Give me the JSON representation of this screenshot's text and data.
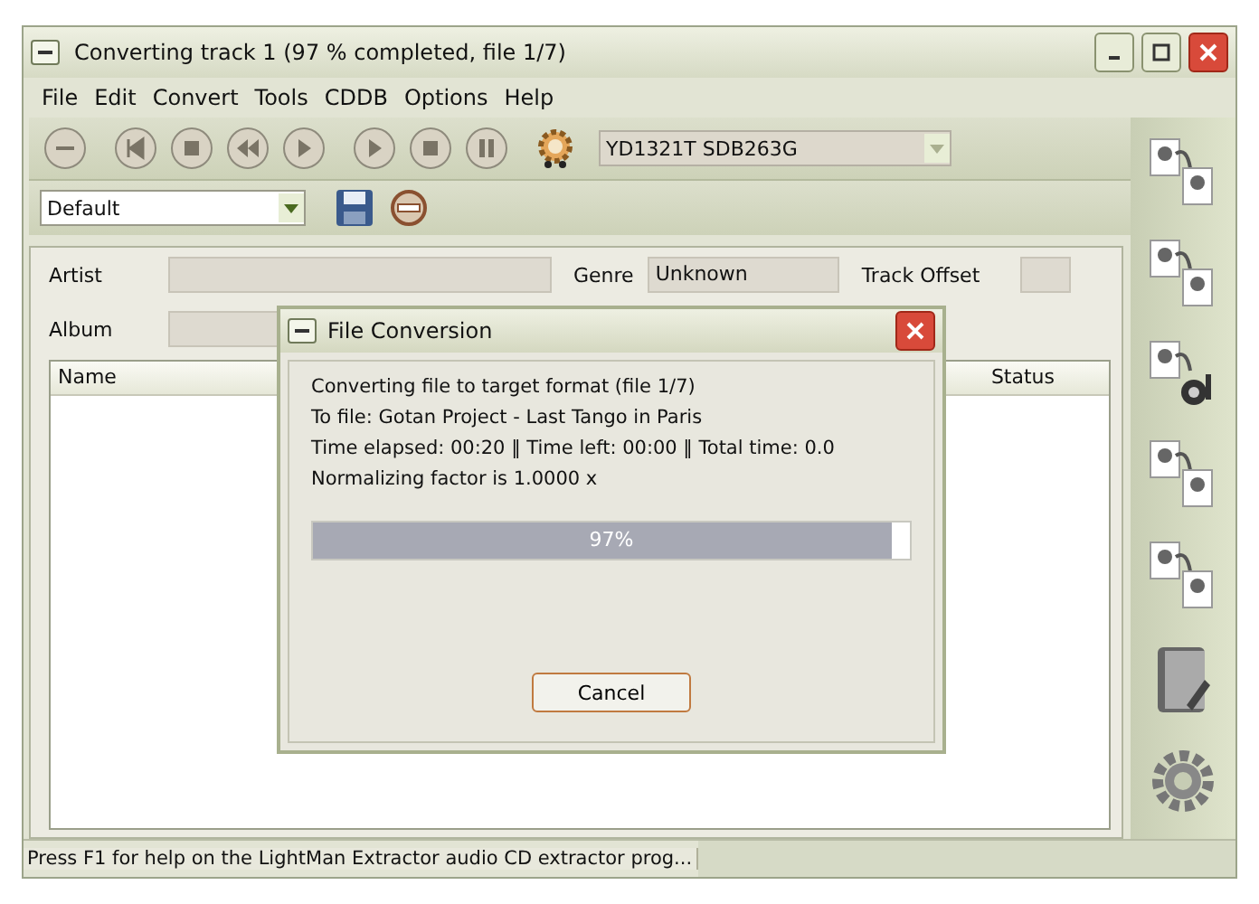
{
  "window": {
    "title": "Converting track 1 (97 % completed, file 1/7)"
  },
  "menu": [
    "File",
    "Edit",
    "Convert",
    "Tools",
    "CDDB",
    "Options",
    "Help"
  ],
  "toolbar": {
    "buttons": [
      {
        "kind": "eject"
      },
      {
        "kind": "previous"
      },
      {
        "kind": "stop"
      },
      {
        "kind": "rewind"
      },
      {
        "kind": "forward"
      },
      {
        "kind": "play"
      },
      {
        "kind": "stop"
      },
      {
        "kind": "pause"
      }
    ],
    "drive": "YD1321T SDB263G",
    "preset": "Default"
  },
  "form": {
    "artist_label": "Artist",
    "album_label": "Album",
    "genre_label": "Genre",
    "genre": "Unknown",
    "track_offset_label": "Track Offset"
  },
  "list": {
    "columns": [
      "Name",
      "Status"
    ]
  },
  "dialog": {
    "title": "File Conversion",
    "lines": [
      "Converting file to target format  (file 1/7)",
      "To file: Gotan Project - Last Tango in Paris",
      "Time elapsed: 00:20  ‖  Time left: 00:00  ‖  Total time:  0.0",
      "Normalizing factor is  1.0000 x"
    ],
    "progress": {
      "level": 0.97,
      "label": "97%"
    },
    "button": "Cancel"
  },
  "sidebar": [
    {
      "kind": "convert"
    },
    {
      "kind": "convert"
    },
    {
      "kind": "play"
    },
    {
      "kind": "convert"
    },
    {
      "kind": "convert"
    },
    {
      "kind": "book"
    },
    {
      "kind": "gear"
    }
  ],
  "status_bar": "Press F1 for help on the LightMan Extractor audio CD extractor prog..."
}
